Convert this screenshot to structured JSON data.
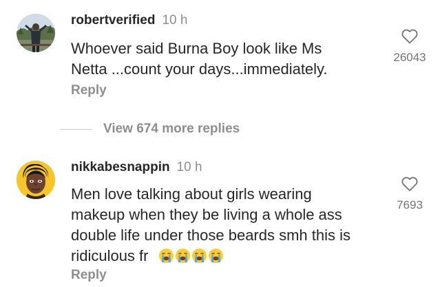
{
  "comments": [
    {
      "username": "robertverified",
      "time": "10 h",
      "text_line1": "Whoever said Burna Boy look like Ms",
      "text_line2": "Netta ...count your days...immediately.",
      "likes": "26043",
      "reply_label": "Reply",
      "avatar_icon": "person-standing-outdoors-avatar",
      "heart_icon": "heart-outline-icon"
    },
    {
      "username": "nikkabesnappin",
      "time": "10 h",
      "text_line1": "Men love talking about girls wearing",
      "text_line2": "makeup when they be living a whole ass",
      "text_line3": "double life under those beards smh this is",
      "text_line4": "ridiculous fr",
      "emojis": [
        "loudly-crying-face",
        "loudly-crying-face",
        "loudly-crying-face",
        "loudly-crying-face"
      ],
      "likes": "7693",
      "reply_label": "Reply",
      "avatar_icon": "cartoon-face-avatar",
      "heart_icon": "heart-outline-icon"
    }
  ],
  "view_more_replies": "View 674 more replies",
  "colors": {
    "text_primary": "#262626",
    "text_secondary": "#8e8e8e",
    "like_count": "#737373",
    "divider": "#c7c7c7",
    "avatar2_bg": "#f7c52a"
  }
}
